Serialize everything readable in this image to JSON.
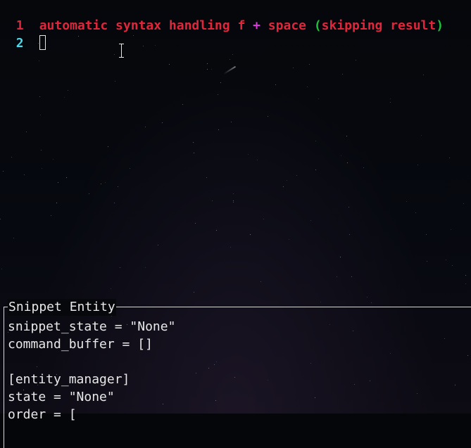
{
  "editor": {
    "lines": [
      {
        "number": "1",
        "segments": [
          {
            "text": "automatic syntax handling f ",
            "color": "#e0263a"
          },
          {
            "text": "+",
            "color": "#d93bd9"
          },
          {
            "text": " space ",
            "color": "#e0263a"
          },
          {
            "text": "(",
            "color": "#1fc23a"
          },
          {
            "text": "skipping result",
            "color": "#e0263a"
          },
          {
            "text": ")",
            "color": "#1fc23a"
          }
        ]
      },
      {
        "number": "2",
        "segments": []
      }
    ],
    "cursor": "block-cursor",
    "mouse_pointer": "ibeam-cursor-icon"
  },
  "panel": {
    "title": "Snippet Entity",
    "lines": [
      "snippet_state = \"None\"",
      "command_buffer = []",
      "",
      "[entity_manager]",
      "state = \"None\"",
      "order = ["
    ]
  },
  "colors": {
    "line_number_current": "#e0263a",
    "line_number_other": "#4fd9e8",
    "text": "#e8e8e8",
    "background": "#04060a"
  }
}
